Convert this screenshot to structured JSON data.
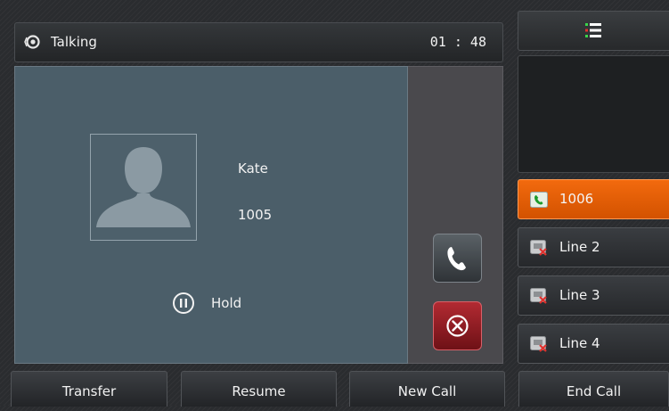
{
  "status": {
    "label": "Talking",
    "timer": "01 : 48"
  },
  "contact": {
    "name": "Kate",
    "number": "1005"
  },
  "hold": {
    "label": "Hold"
  },
  "icons": {
    "status": "speaker-icon",
    "menu": "menu-list-icon",
    "answer": "phone-handset-icon",
    "end": "end-call-icon",
    "hold": "pause-icon",
    "avatar": "contact-avatar-icon"
  },
  "lines": [
    {
      "label": "1006",
      "active": true,
      "icon": "line-active-icon"
    },
    {
      "label": "Line 2",
      "active": false,
      "icon": "line-unregistered-icon"
    },
    {
      "label": "Line 3",
      "active": false,
      "icon": "line-unregistered-icon"
    },
    {
      "label": "Line 4",
      "active": false,
      "icon": "line-unregistered-icon"
    }
  ],
  "softkeys": [
    "Transfer",
    "Resume",
    "New Call",
    "End Call"
  ],
  "colors": {
    "accent": "#e85f06",
    "end_call": "#9e1e26",
    "panel": "#4b5e69",
    "menu_green": "#3bd64a",
    "menu_red": "#e0322e"
  }
}
